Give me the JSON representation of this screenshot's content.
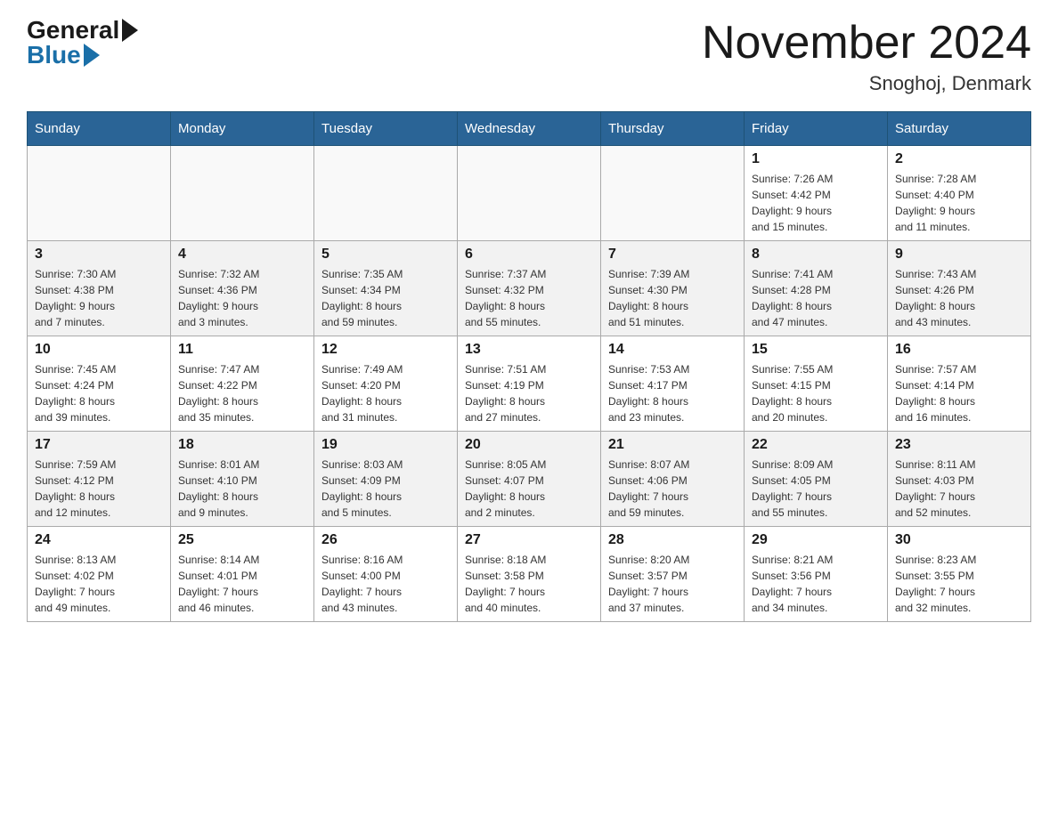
{
  "header": {
    "logo_general": "General",
    "logo_blue": "Blue",
    "month_title": "November 2024",
    "location": "Snoghoj, Denmark"
  },
  "weekdays": [
    "Sunday",
    "Monday",
    "Tuesday",
    "Wednesday",
    "Thursday",
    "Friday",
    "Saturday"
  ],
  "weeks": [
    [
      {
        "day": "",
        "info": ""
      },
      {
        "day": "",
        "info": ""
      },
      {
        "day": "",
        "info": ""
      },
      {
        "day": "",
        "info": ""
      },
      {
        "day": "",
        "info": ""
      },
      {
        "day": "1",
        "info": "Sunrise: 7:26 AM\nSunset: 4:42 PM\nDaylight: 9 hours\nand 15 minutes."
      },
      {
        "day": "2",
        "info": "Sunrise: 7:28 AM\nSunset: 4:40 PM\nDaylight: 9 hours\nand 11 minutes."
      }
    ],
    [
      {
        "day": "3",
        "info": "Sunrise: 7:30 AM\nSunset: 4:38 PM\nDaylight: 9 hours\nand 7 minutes."
      },
      {
        "day": "4",
        "info": "Sunrise: 7:32 AM\nSunset: 4:36 PM\nDaylight: 9 hours\nand 3 minutes."
      },
      {
        "day": "5",
        "info": "Sunrise: 7:35 AM\nSunset: 4:34 PM\nDaylight: 8 hours\nand 59 minutes."
      },
      {
        "day": "6",
        "info": "Sunrise: 7:37 AM\nSunset: 4:32 PM\nDaylight: 8 hours\nand 55 minutes."
      },
      {
        "day": "7",
        "info": "Sunrise: 7:39 AM\nSunset: 4:30 PM\nDaylight: 8 hours\nand 51 minutes."
      },
      {
        "day": "8",
        "info": "Sunrise: 7:41 AM\nSunset: 4:28 PM\nDaylight: 8 hours\nand 47 minutes."
      },
      {
        "day": "9",
        "info": "Sunrise: 7:43 AM\nSunset: 4:26 PM\nDaylight: 8 hours\nand 43 minutes."
      }
    ],
    [
      {
        "day": "10",
        "info": "Sunrise: 7:45 AM\nSunset: 4:24 PM\nDaylight: 8 hours\nand 39 minutes."
      },
      {
        "day": "11",
        "info": "Sunrise: 7:47 AM\nSunset: 4:22 PM\nDaylight: 8 hours\nand 35 minutes."
      },
      {
        "day": "12",
        "info": "Sunrise: 7:49 AM\nSunset: 4:20 PM\nDaylight: 8 hours\nand 31 minutes."
      },
      {
        "day": "13",
        "info": "Sunrise: 7:51 AM\nSunset: 4:19 PM\nDaylight: 8 hours\nand 27 minutes."
      },
      {
        "day": "14",
        "info": "Sunrise: 7:53 AM\nSunset: 4:17 PM\nDaylight: 8 hours\nand 23 minutes."
      },
      {
        "day": "15",
        "info": "Sunrise: 7:55 AM\nSunset: 4:15 PM\nDaylight: 8 hours\nand 20 minutes."
      },
      {
        "day": "16",
        "info": "Sunrise: 7:57 AM\nSunset: 4:14 PM\nDaylight: 8 hours\nand 16 minutes."
      }
    ],
    [
      {
        "day": "17",
        "info": "Sunrise: 7:59 AM\nSunset: 4:12 PM\nDaylight: 8 hours\nand 12 minutes."
      },
      {
        "day": "18",
        "info": "Sunrise: 8:01 AM\nSunset: 4:10 PM\nDaylight: 8 hours\nand 9 minutes."
      },
      {
        "day": "19",
        "info": "Sunrise: 8:03 AM\nSunset: 4:09 PM\nDaylight: 8 hours\nand 5 minutes."
      },
      {
        "day": "20",
        "info": "Sunrise: 8:05 AM\nSunset: 4:07 PM\nDaylight: 8 hours\nand 2 minutes."
      },
      {
        "day": "21",
        "info": "Sunrise: 8:07 AM\nSunset: 4:06 PM\nDaylight: 7 hours\nand 59 minutes."
      },
      {
        "day": "22",
        "info": "Sunrise: 8:09 AM\nSunset: 4:05 PM\nDaylight: 7 hours\nand 55 minutes."
      },
      {
        "day": "23",
        "info": "Sunrise: 8:11 AM\nSunset: 4:03 PM\nDaylight: 7 hours\nand 52 minutes."
      }
    ],
    [
      {
        "day": "24",
        "info": "Sunrise: 8:13 AM\nSunset: 4:02 PM\nDaylight: 7 hours\nand 49 minutes."
      },
      {
        "day": "25",
        "info": "Sunrise: 8:14 AM\nSunset: 4:01 PM\nDaylight: 7 hours\nand 46 minutes."
      },
      {
        "day": "26",
        "info": "Sunrise: 8:16 AM\nSunset: 4:00 PM\nDaylight: 7 hours\nand 43 minutes."
      },
      {
        "day": "27",
        "info": "Sunrise: 8:18 AM\nSunset: 3:58 PM\nDaylight: 7 hours\nand 40 minutes."
      },
      {
        "day": "28",
        "info": "Sunrise: 8:20 AM\nSunset: 3:57 PM\nDaylight: 7 hours\nand 37 minutes."
      },
      {
        "day": "29",
        "info": "Sunrise: 8:21 AM\nSunset: 3:56 PM\nDaylight: 7 hours\nand 34 minutes."
      },
      {
        "day": "30",
        "info": "Sunrise: 8:23 AM\nSunset: 3:55 PM\nDaylight: 7 hours\nand 32 minutes."
      }
    ]
  ]
}
